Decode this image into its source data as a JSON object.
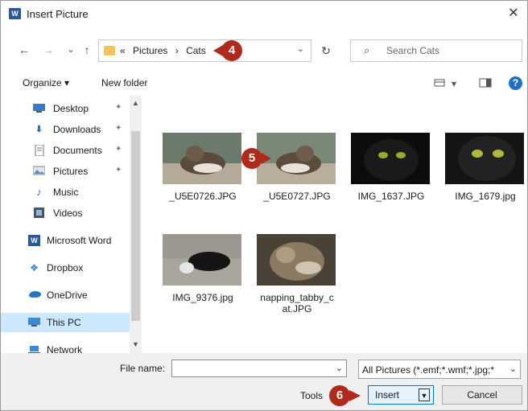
{
  "window": {
    "title": "Insert Picture",
    "app_icon": "W",
    "close_glyph": "✕"
  },
  "nav": {
    "back_glyph": "←",
    "forward_glyph": "→",
    "recent_glyph": "⌄",
    "up_glyph": "↑",
    "overflow_glyph": "«",
    "breadcrumb": [
      "Pictures",
      "Cats"
    ],
    "sep": "›",
    "dropdown_glyph": "⌄",
    "refresh_glyph": "↻",
    "search_placeholder": "Search Cats",
    "search_glyph": "⌕"
  },
  "commandbar": {
    "organize_label": "Organize ▾",
    "new_folder_label": "New folder",
    "view_dd": "▾",
    "help_label": "?"
  },
  "sidebar": {
    "items": [
      {
        "label": "Desktop",
        "icon": "desktop-icon",
        "pinned": true
      },
      {
        "label": "Downloads",
        "icon": "downloads-icon",
        "pinned": true
      },
      {
        "label": "Documents",
        "icon": "documents-icon",
        "pinned": true
      },
      {
        "label": "Pictures",
        "icon": "pictures-icon",
        "pinned": true
      },
      {
        "label": "Music",
        "icon": "music-icon",
        "pinned": false
      },
      {
        "label": "Videos",
        "icon": "videos-icon",
        "pinned": false
      },
      {
        "label": "Microsoft Word",
        "icon": "word-icon",
        "pinned": false
      },
      {
        "label": "Dropbox",
        "icon": "dropbox-icon",
        "pinned": false
      },
      {
        "label": "OneDrive",
        "icon": "onedrive-icon",
        "pinned": false
      },
      {
        "label": "This PC",
        "icon": "pc-icon",
        "pinned": false,
        "selected": true
      },
      {
        "label": "Network",
        "icon": "network-icon",
        "pinned": false
      }
    ],
    "pin_glyph": "📌",
    "scroll_up": "▲",
    "scroll_down": "▼"
  },
  "files": [
    {
      "name": "_U5E0726.JPG",
      "thumb": "cat-thumb-1"
    },
    {
      "name": "_U5E0727.JPG",
      "thumb": "cat-thumb-2"
    },
    {
      "name": "IMG_1637.JPG",
      "thumb": "cat-thumb-3"
    },
    {
      "name": "IMG_1679.jpg",
      "thumb": "cat-thumb-4"
    },
    {
      "name": "IMG_9376.jpg",
      "thumb": "cat-thumb-5"
    },
    {
      "name_line1": "napping_tabby_c",
      "name_line2": "at.JPG",
      "thumb": "cat-thumb-6"
    }
  ],
  "footer": {
    "filename_label": "File name:",
    "filename_value": "",
    "filter_value": "All Pictures (*.emf;*.wmf;*.jpg;*",
    "dd_glyph": "⌄",
    "tools_label": "Tools",
    "tools_dd": "▼",
    "insert_label": "Insert",
    "insert_split": "▼",
    "cancel_label": "Cancel"
  },
  "callouts": [
    "4",
    "5",
    "6"
  ],
  "colors": {
    "callout": "#b0291d",
    "accent": "#0078d7",
    "selection": "#cce8ff"
  }
}
